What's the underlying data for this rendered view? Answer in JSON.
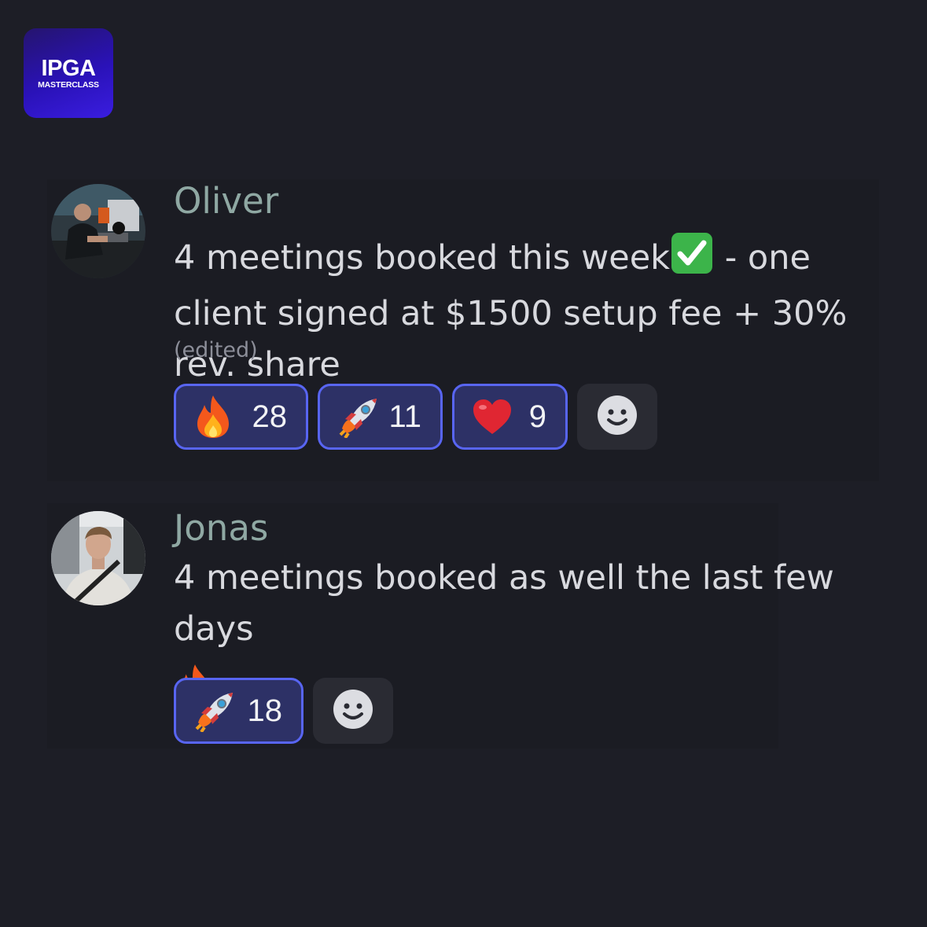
{
  "logo": {
    "main": "IPGA",
    "sub": "MASTERCLASS"
  },
  "messages": [
    {
      "author": "Oliver",
      "text_part1": "4 meetings booked this week",
      "text_part2": " - one client signed at $1500 setup fee + 30% rev. share",
      "edited": "(edited)",
      "reactions": [
        {
          "emoji": "fire-emoji",
          "count": "28"
        },
        {
          "emoji": "rocket-emoji",
          "count": "11"
        },
        {
          "emoji": "red-heart-emoji",
          "count": "9"
        }
      ]
    },
    {
      "author": "Jonas",
      "text": "4 meetings booked as well the last few days",
      "reactions": [
        {
          "emoji": "rocket-emoji",
          "count": "18"
        }
      ]
    }
  ],
  "colors": {
    "background": "#1d1e26",
    "author_name": "#8fa8a3",
    "message_text": "#d8d9de",
    "reaction_border": "#5865f2",
    "reaction_fill": "#2d3166"
  }
}
